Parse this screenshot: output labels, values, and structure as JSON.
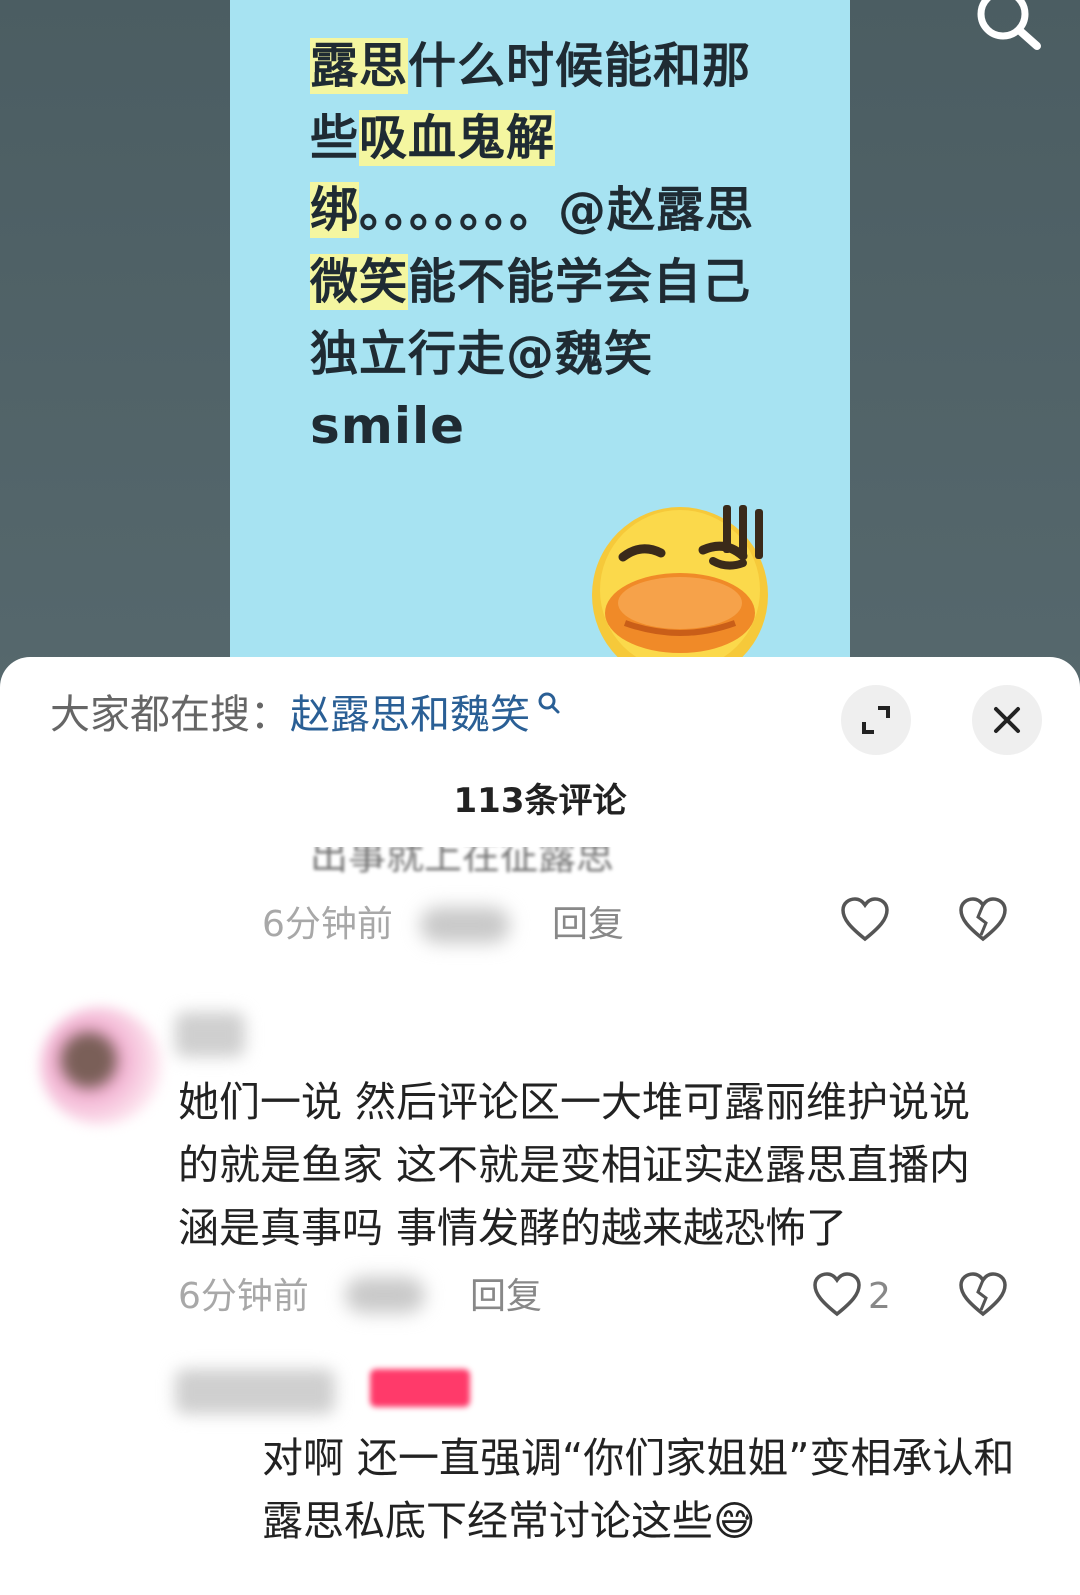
{
  "video": {
    "text_parts": [
      {
        "t": "露思",
        "hl": true
      },
      {
        "t": "什么时候能和那些",
        "hl": false
      },
      {
        "t": "吸血鬼解绑",
        "hl": true
      },
      {
        "t": "。。。。。。。@赵露思",
        "hl": false
      },
      {
        "t": "微笑",
        "hl": true
      },
      {
        "t": "能不能学会自己独立行走@魏笑",
        "hl": false
      }
    ],
    "text_last": "smile",
    "emoji": "sweating-duck-emoji",
    "top_icon": "search-icon"
  },
  "sheet": {
    "suggest_prefix": "大家都在搜：",
    "suggest_link": "赵露思和魏笑",
    "expand_icon": "expand-icon",
    "close_icon": "close-icon",
    "comment_count": "113条评论"
  },
  "comments": [
    {
      "text": "出事就上在征露思",
      "time": "6分钟前",
      "reply": "回复",
      "likes": ""
    },
    {
      "text": "她们一说 然后评论区一大堆可露丽维护说说的就是鱼家 这不就是变相证实赵露思直播内涵是真事吗 事情发酵的越来越恐怖了",
      "time": "6分钟前",
      "reply": "回复",
      "likes": "2"
    },
    {
      "text": "对啊 还一直强调“你们家姐姐”变相承认和露思私底下经常讨论这些😅",
      "badge": "",
      "time": "",
      "reply": "",
      "likes": ""
    }
  ],
  "colors": {
    "video_card": "#a7e3f2",
    "highlight": "#f4f6a0",
    "link": "#2a5f95",
    "badge": "#ff3a6a"
  }
}
